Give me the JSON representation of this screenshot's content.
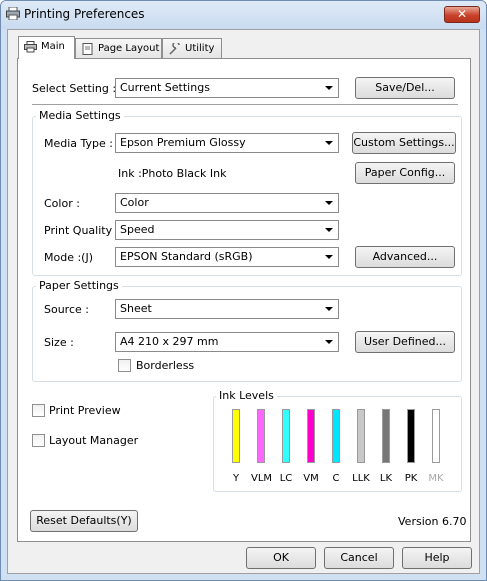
{
  "window": {
    "title": "Printing Preferences",
    "close_label": "✕"
  },
  "tabs": [
    {
      "label": "Main"
    },
    {
      "label": "Page Layout"
    },
    {
      "label": "Utility"
    }
  ],
  "main": {
    "select_setting": {
      "label": "Select Setting :",
      "value": "Current Settings",
      "button": "Save/Del..."
    },
    "media_settings": {
      "title": "Media Settings",
      "media_type": {
        "label": "Media Type :",
        "value": "Epson Premium Glossy"
      },
      "custom_button": "Custom Settings...",
      "ink_text": "Ink :Photo Black Ink",
      "paper_config_button": "Paper Config...",
      "color": {
        "label": "Color :",
        "value": "Color"
      },
      "print_quality": {
        "label": "Print Quality :",
        "value": "Speed"
      },
      "mode": {
        "label": "Mode :(J)",
        "value": "EPSON Standard (sRGB)"
      },
      "advanced_button": "Advanced..."
    },
    "paper_settings": {
      "title": "Paper Settings",
      "source": {
        "label": "Source :",
        "value": "Sheet"
      },
      "size": {
        "label": "Size :",
        "value": "A4 210 x 297 mm"
      },
      "user_defined_button": "User Defined...",
      "borderless_label": "Borderless",
      "borderless_checked": false
    },
    "print_preview": {
      "label": "Print Preview",
      "checked": false
    },
    "layout_manager": {
      "label": "Layout Manager",
      "checked": false
    },
    "ink_levels": {
      "title": "Ink Levels",
      "inks": [
        {
          "name": "Y",
          "color": "#ffff00",
          "level": 1.0
        },
        {
          "name": "VLM",
          "color": "#ff66ff",
          "level": 1.0
        },
        {
          "name": "LC",
          "color": "#33ffff",
          "level": 1.0
        },
        {
          "name": "VM",
          "color": "#ff00cc",
          "level": 1.0
        },
        {
          "name": "C",
          "color": "#00e5ff",
          "level": 1.0
        },
        {
          "name": "LLK",
          "color": "#c8c8c8",
          "level": 1.0
        },
        {
          "name": "LK",
          "color": "#777777",
          "level": 1.0
        },
        {
          "name": "PK",
          "color": "#000000",
          "level": 1.0
        },
        {
          "name": "MK",
          "color": "#d8d8d8",
          "level": 0.0
        }
      ]
    },
    "reset_button": "Reset Defaults(Y)",
    "version": "Version 6.70"
  },
  "footer": {
    "ok": "OK",
    "cancel": "Cancel",
    "help": "Help"
  }
}
